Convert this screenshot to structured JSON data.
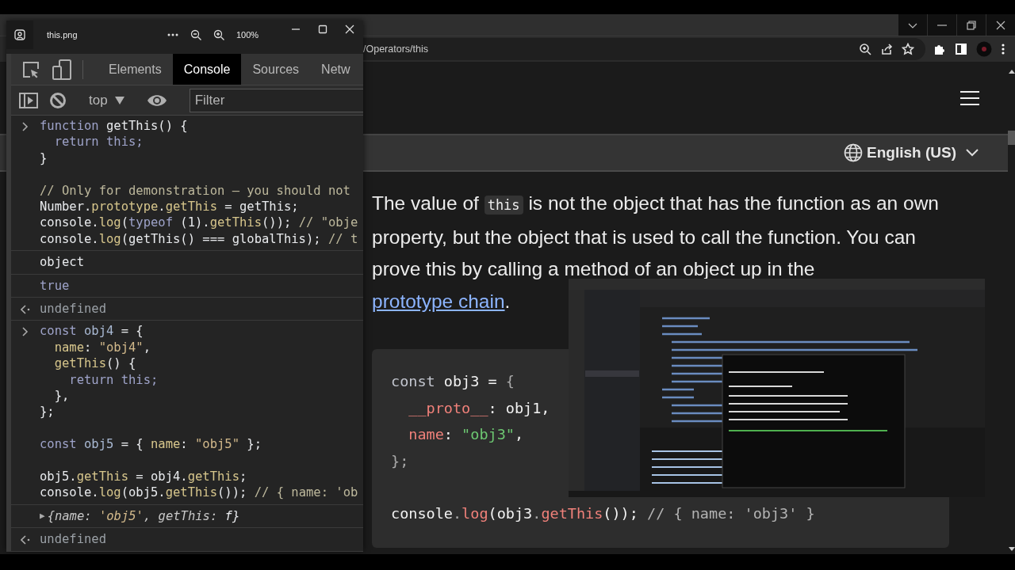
{
  "browser": {
    "address": "/Operators/this"
  },
  "page": {
    "language": "English (US)",
    "paragraph": [
      {
        "kind": "text",
        "text": "The value of "
      },
      {
        "kind": "code",
        "text": "this"
      },
      {
        "kind": "text",
        "text": " is not the object that has the function as an own property, but the object that is used to call the function. You can prove this by calling a method of an object up in the "
      },
      {
        "kind": "link",
        "text": "prototype chain"
      },
      {
        "kind": "text",
        "text": "."
      }
    ],
    "code_block": {
      "blocks": [
        [
          [
            {
              "text": "const ",
              "kind": "keyword"
            },
            {
              "text": "obj3 = ",
              "kind": "plain"
            },
            {
              "text": "{",
              "kind": "punct"
            }
          ],
          [
            {
              "text": "  __proto__",
              "kind": "property"
            },
            {
              "text": ": obj1,",
              "kind": "plain"
            }
          ],
          [
            {
              "text": "  name",
              "kind": "property"
            },
            {
              "text": ": ",
              "kind": "plain"
            },
            {
              "text": "\"obj3\"",
              "kind": "string"
            },
            {
              "text": ",",
              "kind": "plain"
            }
          ],
          [
            {
              "text": "};",
              "kind": "punct"
            }
          ]
        ],
        [
          [
            {
              "text": "console",
              "kind": "plain"
            },
            {
              "text": ".",
              "kind": "punct"
            },
            {
              "text": "log",
              "kind": "property"
            },
            {
              "text": "(obj3",
              "kind": "plain"
            },
            {
              "text": ".",
              "kind": "punct"
            },
            {
              "text": "getThis",
              "kind": "property"
            },
            {
              "text": "()); ",
              "kind": "plain"
            },
            {
              "text": "// { name: 'obj3' }",
              "kind": "comment"
            }
          ]
        ]
      ]
    }
  },
  "viewer": {
    "title": "this.png",
    "zoom": "100%",
    "devtools": {
      "tabs": [
        {
          "label": "Elements",
          "selected": false
        },
        {
          "label": "Console",
          "selected": true
        },
        {
          "label": "Sources",
          "selected": false
        },
        {
          "label": "Netw",
          "selected": false
        }
      ],
      "context": "top",
      "filter_placeholder": "Filter",
      "console": [
        {
          "kind": "input",
          "blocks": [
            [
              [
                {
                  "text": "function ",
                  "kind": "keyword"
                },
                {
                  "text": "getThis() {",
                  "kind": "plain"
                }
              ],
              [
                {
                  "text": "  return this;",
                  "kind": "keyword"
                }
              ],
              [
                {
                  "text": "}",
                  "kind": "plain"
                }
              ]
            ],
            [
              [
                {
                  "text": "// Only for demonstration — you should not",
                  "kind": "comment"
                }
              ],
              [
                {
                  "text": "Number.",
                  "kind": "plain"
                },
                {
                  "text": "prototype",
                  "kind": "property"
                },
                {
                  "text": ".",
                  "kind": "plain"
                },
                {
                  "text": "getThis",
                  "kind": "property"
                },
                {
                  "text": " = getThis;",
                  "kind": "plain"
                }
              ],
              [
                {
                  "text": "console.",
                  "kind": "plain"
                },
                {
                  "text": "log",
                  "kind": "property"
                },
                {
                  "text": "(",
                  "kind": "plain"
                },
                {
                  "text": "typeof",
                  "kind": "keyword"
                },
                {
                  "text": " (1).",
                  "kind": "plain"
                },
                {
                  "text": "getThis",
                  "kind": "property"
                },
                {
                  "text": "()); ",
                  "kind": "plain"
                },
                {
                  "text": "// \"obje",
                  "kind": "comment"
                }
              ],
              [
                {
                  "text": "console.",
                  "kind": "plain"
                },
                {
                  "text": "log",
                  "kind": "property"
                },
                {
                  "text": "(getThis() === globalThis); ",
                  "kind": "plain"
                },
                {
                  "text": "// t",
                  "kind": "comment"
                }
              ]
            ]
          ]
        },
        {
          "kind": "log",
          "tokens": [
            {
              "text": "object",
              "kind": "plain"
            }
          ]
        },
        {
          "kind": "log",
          "tokens": [
            {
              "text": "true",
              "kind": "keyword"
            }
          ]
        },
        {
          "kind": "return",
          "text": "undefined"
        },
        {
          "kind": "input",
          "blocks": [
            [
              [
                {
                  "text": "const ",
                  "kind": "keyword"
                },
                {
                  "text": "obj4",
                  "kind": "variable"
                },
                {
                  "text": " = {",
                  "kind": "plain"
                }
              ],
              [
                {
                  "text": "  name",
                  "kind": "property"
                },
                {
                  "text": ": ",
                  "kind": "plain"
                },
                {
                  "text": "\"obj4\"",
                  "kind": "string"
                },
                {
                  "text": ",",
                  "kind": "plain"
                }
              ],
              [
                {
                  "text": "  getThis",
                  "kind": "property"
                },
                {
                  "text": "() {",
                  "kind": "plain"
                }
              ],
              [
                {
                  "text": "    return this;",
                  "kind": "keyword"
                }
              ],
              [
                {
                  "text": "  },",
                  "kind": "plain"
                }
              ],
              [
                {
                  "text": "};",
                  "kind": "plain"
                }
              ]
            ],
            [
              [
                {
                  "text": "const ",
                  "kind": "keyword"
                },
                {
                  "text": "obj5",
                  "kind": "variable"
                },
                {
                  "text": " = { ",
                  "kind": "plain"
                },
                {
                  "text": "name",
                  "kind": "property"
                },
                {
                  "text": ": ",
                  "kind": "plain"
                },
                {
                  "text": "\"obj5\"",
                  "kind": "string"
                },
                {
                  "text": " };",
                  "kind": "plain"
                }
              ]
            ],
            [
              [
                {
                  "text": "obj5.",
                  "kind": "plain"
                },
                {
                  "text": "getThis",
                  "kind": "property"
                },
                {
                  "text": " = obj4.",
                  "kind": "plain"
                },
                {
                  "text": "getThis",
                  "kind": "property"
                },
                {
                  "text": ";",
                  "kind": "plain"
                }
              ],
              [
                {
                  "text": "console.",
                  "kind": "plain"
                },
                {
                  "text": "log",
                  "kind": "property"
                },
                {
                  "text": "(obj5.",
                  "kind": "plain"
                },
                {
                  "text": "getThis",
                  "kind": "property"
                },
                {
                  "text": "()); ",
                  "kind": "plain"
                },
                {
                  "text": "// { name: 'ob",
                  "kind": "comment"
                }
              ]
            ]
          ]
        },
        {
          "kind": "preview",
          "expander": "▶",
          "tokens": [
            {
              "text": "{name: ",
              "kind": "italic"
            },
            {
              "text": "'obj5'",
              "kind": "string"
            },
            {
              "text": ", getThis: ",
              "kind": "italic"
            },
            {
              "text": "f}",
              "kind": "plain"
            }
          ]
        },
        {
          "kind": "return",
          "text": "undefined"
        }
      ]
    }
  }
}
